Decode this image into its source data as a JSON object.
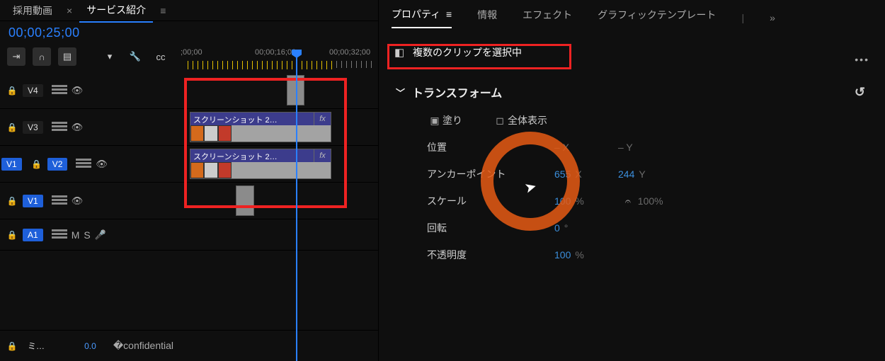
{
  "timeline": {
    "tabs": {
      "seq1": "採用動画",
      "seq2": "サービス紹介"
    },
    "timecode": "00;00;25;00",
    "ruler": {
      "t0": ";00;00",
      "t1": "00;00;16;00",
      "t2": "00;00;32;00"
    },
    "tracks": {
      "v4": "V4",
      "v3": "V3",
      "v2": "V2",
      "v1": "V1",
      "a1": "A1",
      "source_v1": "V1",
      "m": "M",
      "s": "S",
      "mix": "ミ…"
    },
    "clips": {
      "v3_name": "スクリーンショット 2…",
      "v2_name": "スクリーンショット 2…",
      "fx": "fx"
    },
    "zoom": "0.0"
  },
  "properties": {
    "tabs": {
      "prop": "プロパティ",
      "info": "情報",
      "effect": "エフェクト",
      "gfx": "グラフィックテンプレート"
    },
    "selected_header": "複数のクリップを選択中",
    "transform": {
      "title": "トランスフォーム",
      "fill": "塗り",
      "fullview": "全体表示",
      "position": "位置",
      "pos_x": "– X",
      "pos_y": "– Y",
      "anchor": "アンカーポイント",
      "anchor_x": "655",
      "anchor_xu": "X",
      "anchor_y": "244",
      "anchor_yu": "Y",
      "scale": "スケール",
      "scale_v": "100",
      "scale_u": "%",
      "scale_v2": "100",
      "scale_u2": "%",
      "rotation": "回転",
      "rot_v": "0",
      "rot_u": "°",
      "opacity": "不透明度",
      "op_v": "100",
      "op_u": "%"
    }
  }
}
